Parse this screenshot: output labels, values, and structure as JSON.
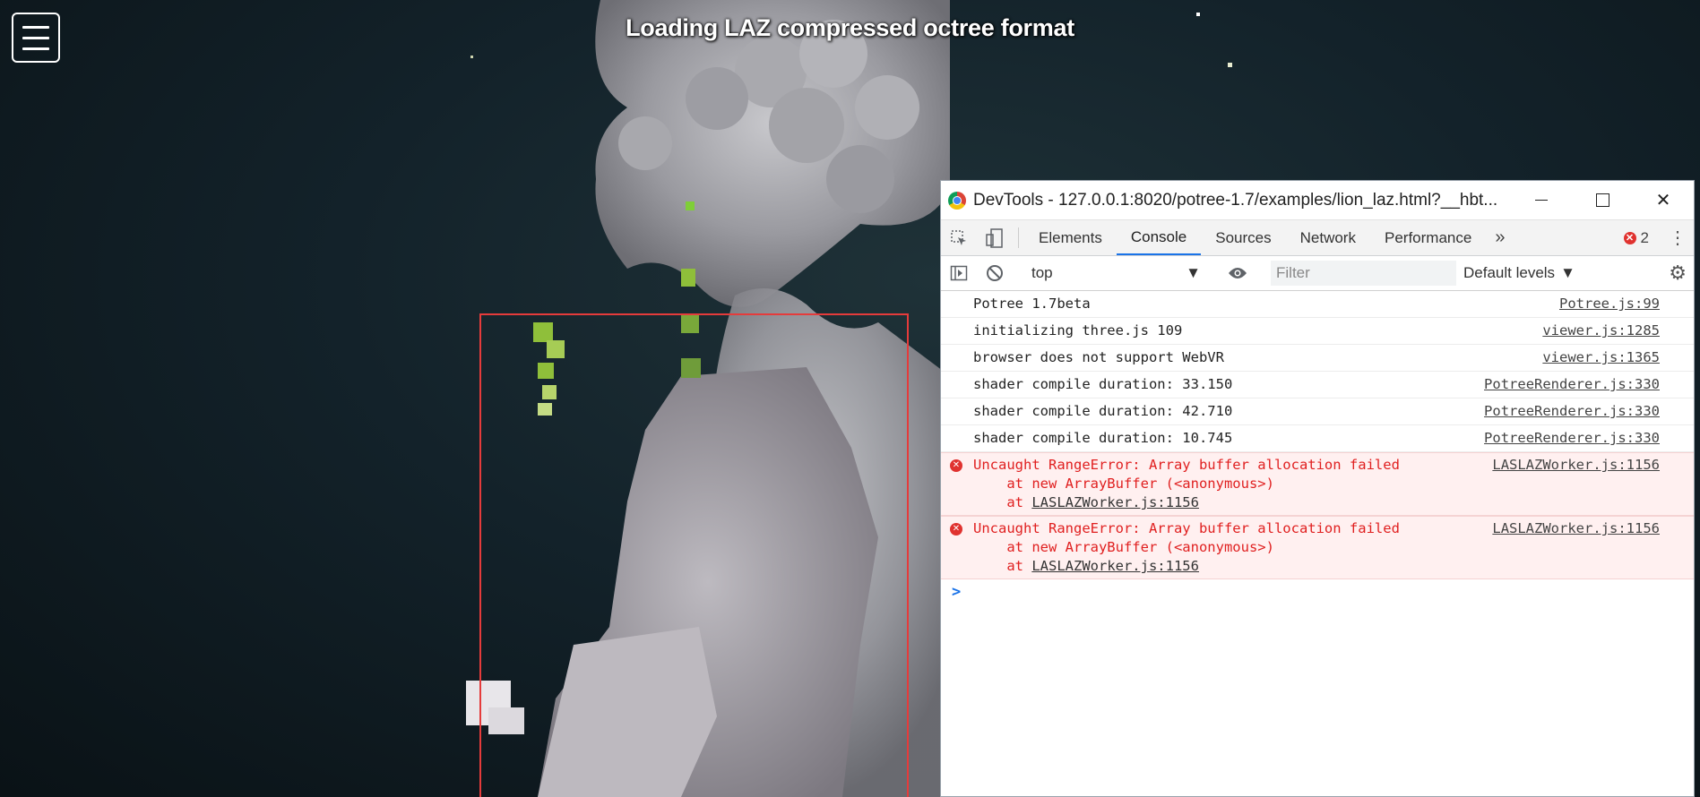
{
  "viewer": {
    "title": "Loading LAZ compressed octree format",
    "menu_label": "Menu"
  },
  "devtools": {
    "title": "DevTools - 127.0.0.1:8020/potree-1.7/examples/lion_laz.html?__hbt...",
    "tabs": [
      "Elements",
      "Console",
      "Sources",
      "Network",
      "Performance"
    ],
    "active_tab": "Console",
    "more_tabs": "»",
    "error_count": "2",
    "context": "top",
    "filter_placeholder": "Filter",
    "levels": "Default levels",
    "logs": [
      {
        "message": "Potree 1.7beta",
        "source": "Potree.js:99"
      },
      {
        "message": "initializing three.js 109",
        "source": "viewer.js:1285"
      },
      {
        "message": "browser does not support WebVR",
        "source": "viewer.js:1365"
      },
      {
        "message": "shader compile duration: 33.150",
        "source": "PotreeRenderer.js:330"
      },
      {
        "message": "shader compile duration: 42.710",
        "source": "PotreeRenderer.js:330"
      },
      {
        "message": "shader compile duration: 10.745",
        "source": "PotreeRenderer.js:330"
      }
    ],
    "errors": [
      {
        "message": "Uncaught RangeError: Array buffer allocation failed",
        "line2": "    at new ArrayBuffer (<anonymous>)",
        "line3_prefix": "    at ",
        "line3_link": "LASLAZWorker.js:1156",
        "source": "LASLAZWorker.js:1156"
      },
      {
        "message": "Uncaught RangeError: Array buffer allocation failed",
        "line2": "    at new ArrayBuffer (<anonymous>)",
        "line3_prefix": "    at ",
        "line3_link": "LASLAZWorker.js:1156",
        "source": "LASLAZWorker.js:1156"
      }
    ],
    "prompt": ">"
  },
  "colors": {
    "selection_box": "#e53b3b",
    "error_text": "#e02020",
    "active_tab": "#1a73e8"
  }
}
